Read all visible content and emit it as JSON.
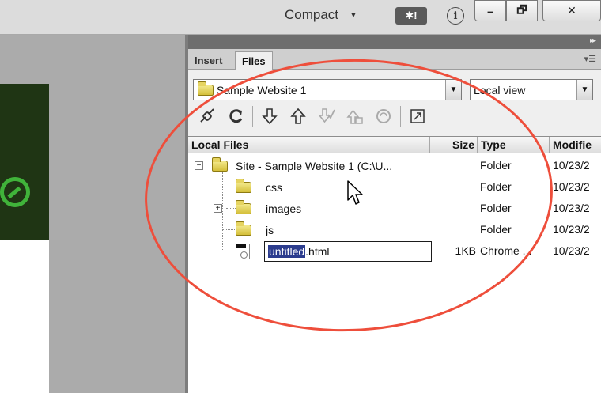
{
  "topbar": {
    "workspace_label": "Compact",
    "live_label": "✱!",
    "info_glyph": "i",
    "minimize_glyph": "–",
    "restore_glyph": "🗗",
    "close_glyph": "✕"
  },
  "panel": {
    "tabs": [
      {
        "label": "Insert",
        "active": false
      },
      {
        "label": "Files",
        "active": true
      }
    ],
    "site_selector": {
      "value": "Sample Website 1"
    },
    "view_selector": {
      "value": "Local view"
    },
    "toolbar_icons": [
      "connect-icon",
      "refresh-icon",
      "get-files-icon",
      "put-files-icon",
      "check-out-icon",
      "check-in-icon",
      "synchronize-icon",
      "expand-panel-icon"
    ],
    "columns": {
      "local_files": "Local Files",
      "size": "Size",
      "type": "Type",
      "modified": "Modifie"
    },
    "rows": [
      {
        "name": "Site - Sample Website 1 (C:\\U...",
        "size": "",
        "type": "Folder",
        "modified": "10/23/2"
      },
      {
        "name": "css",
        "size": "",
        "type": "Folder",
        "modified": "10/23/2"
      },
      {
        "name": "images",
        "size": "",
        "type": "Folder",
        "modified": "10/23/2"
      },
      {
        "name": "js",
        "size": "",
        "type": "Folder",
        "modified": "10/23/2"
      },
      {
        "name_selected": "untitled",
        "name_rest": ".html",
        "size": "1KB",
        "type": "Chrome ...",
        "modified": "10/23/2"
      }
    ]
  },
  "colors": {
    "annotation": "#ee4e3b",
    "selection": "#2c3c8e",
    "folder": "#e6d461",
    "page_header": "#1f3514",
    "logo": "#40b33a"
  }
}
